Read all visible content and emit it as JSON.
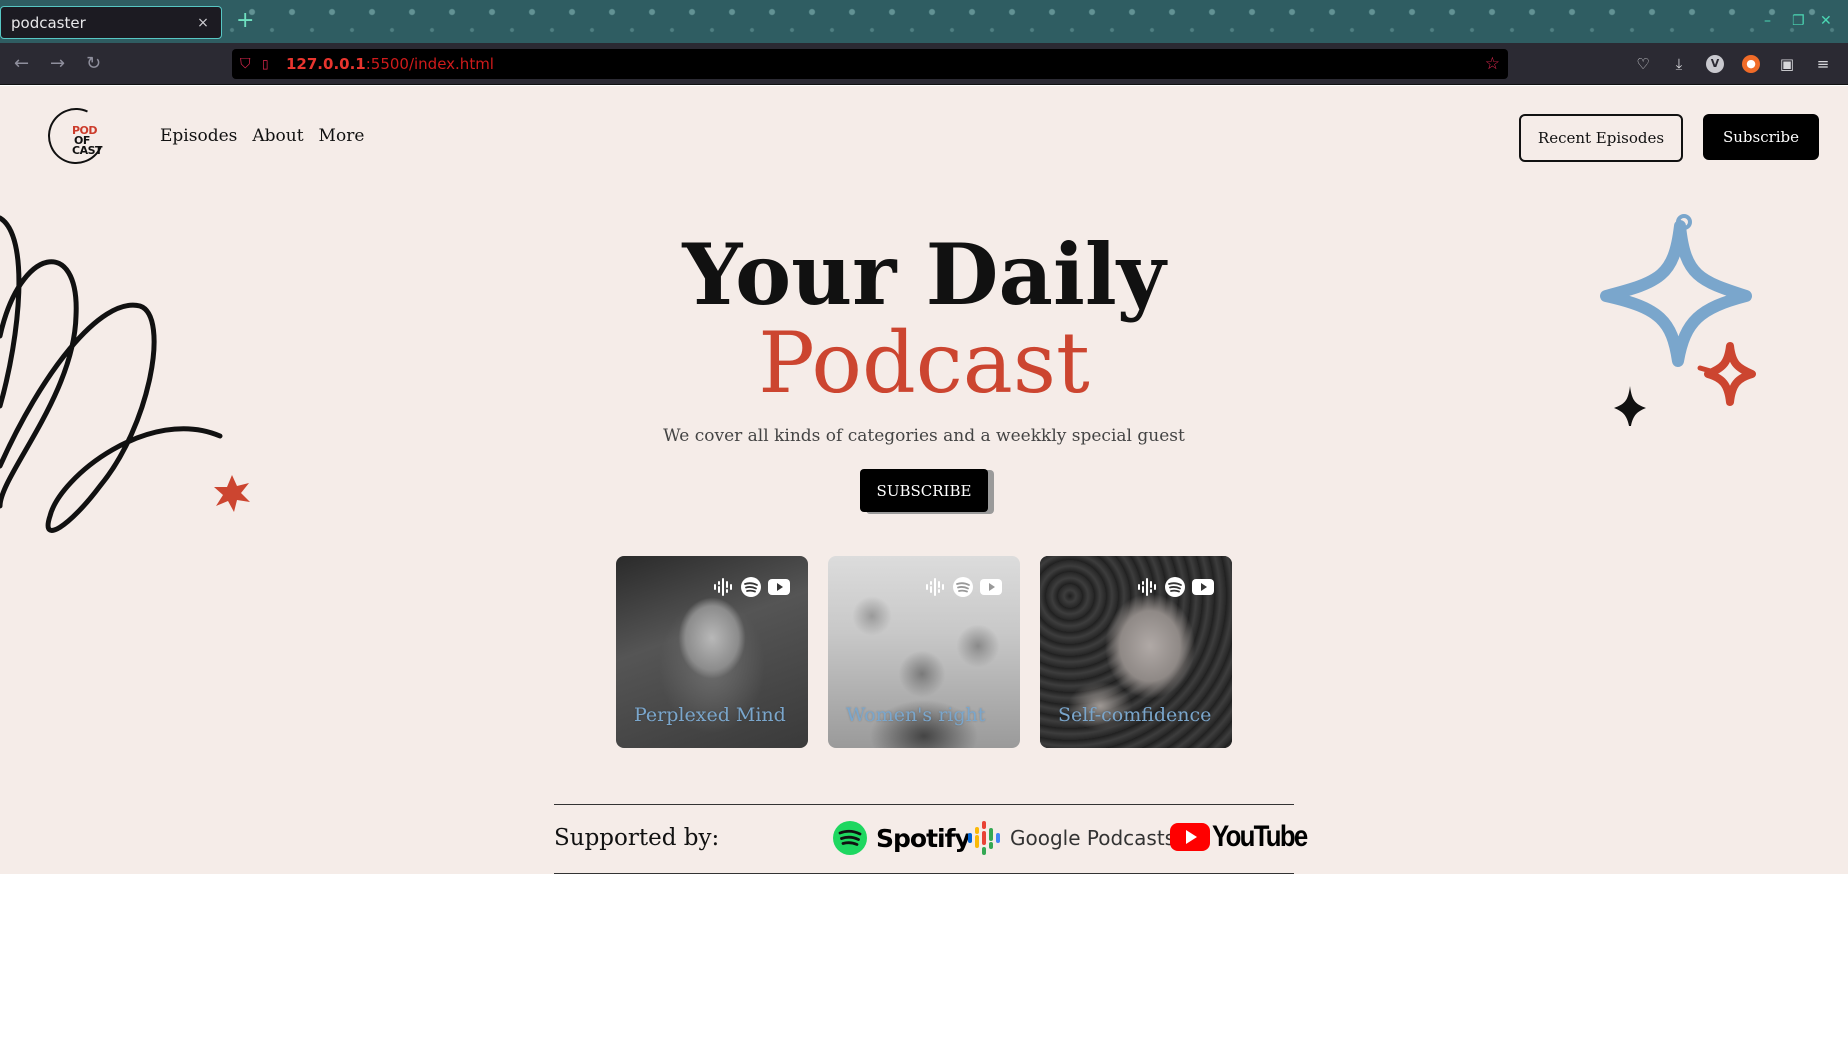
{
  "browser": {
    "tab_title": "podcaster",
    "tab_close": "×",
    "new_tab": "+",
    "url_host": "127.0.0.1",
    "url_rest": ":5500/index.html",
    "window_controls": {
      "minimize": "–",
      "restore": "❐",
      "close": "✕"
    }
  },
  "site": {
    "logo": {
      "pod": "POD",
      "of": "OF",
      "cast": "CAST"
    },
    "nav": [
      "Episodes",
      "About",
      "More"
    ],
    "recent_episodes_label": "Recent Episodes",
    "subscribe_label": "Subscribe"
  },
  "hero": {
    "title_line1": "Your Daily",
    "title_line2": "Podcast",
    "subtitle": "We cover all kinds of categories and a weekkly special guest",
    "cta_label": "SUBSCRIBE"
  },
  "cards": [
    {
      "label": "Perplexed Mind",
      "icons": [
        "google-podcasts-icon",
        "spotify-icon",
        "youtube-icon"
      ]
    },
    {
      "label": "Women's right",
      "icons": [
        "google-podcasts-icon",
        "spotify-icon",
        "youtube-icon"
      ]
    },
    {
      "label": "Self-comfidence",
      "icons": [
        "google-podcasts-icon",
        "spotify-icon",
        "youtube-icon"
      ]
    }
  ],
  "support": {
    "label": "Supported by:",
    "brands": {
      "spotify": "Spotify",
      "google": "Google Podcasts",
      "youtube": "YouTube"
    }
  },
  "colors": {
    "page_bg": "#f5ece8",
    "accent_red": "#cc4530",
    "accent_blue": "#7aa6cc",
    "tabbar": "#2f5d62"
  }
}
